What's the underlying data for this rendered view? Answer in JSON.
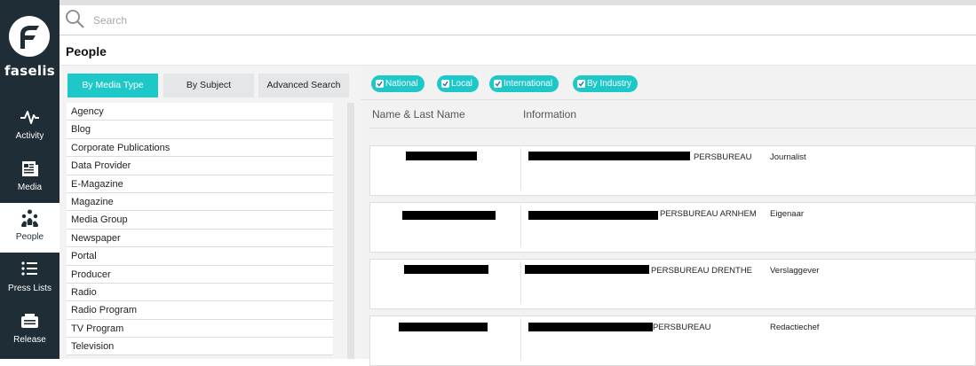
{
  "app": {
    "name": "faselis"
  },
  "sidebar": {
    "items": [
      {
        "label": "Activity",
        "icon": "activity-icon"
      },
      {
        "label": "Media",
        "icon": "newspaper-icon"
      },
      {
        "label": "People",
        "icon": "people-icon",
        "active": true
      },
      {
        "label": "Press Lists",
        "icon": "list-icon"
      },
      {
        "label": "Release",
        "icon": "release-icon"
      }
    ]
  },
  "search": {
    "placeholder": "Search",
    "value": ""
  },
  "page": {
    "title": "People"
  },
  "tabs": [
    {
      "label": "By Media Type",
      "active": true
    },
    {
      "label": "By Subject",
      "active": false
    },
    {
      "label": "Advanced Search",
      "active": false
    }
  ],
  "media_types": [
    "Agency",
    "Blog",
    "Corporate Publications",
    "Data Provider",
    "E-Magazine",
    "Magazine",
    "Media Group",
    "Newspaper",
    "Portal",
    "Producer",
    "Radio",
    "Radio Program",
    "TV Program",
    "Television"
  ],
  "filters": [
    {
      "label": "National",
      "checked": true
    },
    {
      "label": "Local",
      "checked": true
    },
    {
      "label": "International",
      "checked": true
    },
    {
      "label": "By Industry",
      "checked": true
    }
  ],
  "table": {
    "columns": [
      "Name & Last Name",
      "Information"
    ],
    "rows": [
      {
        "organization": "PERSBUREAU",
        "role": "Journalist"
      },
      {
        "organization": "PERSBUREAU ARNHEM",
        "role": "Eigenaar"
      },
      {
        "organization": "PERSBUREAU DRENTHE",
        "role": "Verslaggever"
      },
      {
        "organization": "PERSBUREAU",
        "role": "Redactiechef"
      }
    ]
  },
  "colors": {
    "sidebar": "#1f2d36",
    "accent": "#1ec8c8",
    "panel": "#f3f3f3"
  }
}
